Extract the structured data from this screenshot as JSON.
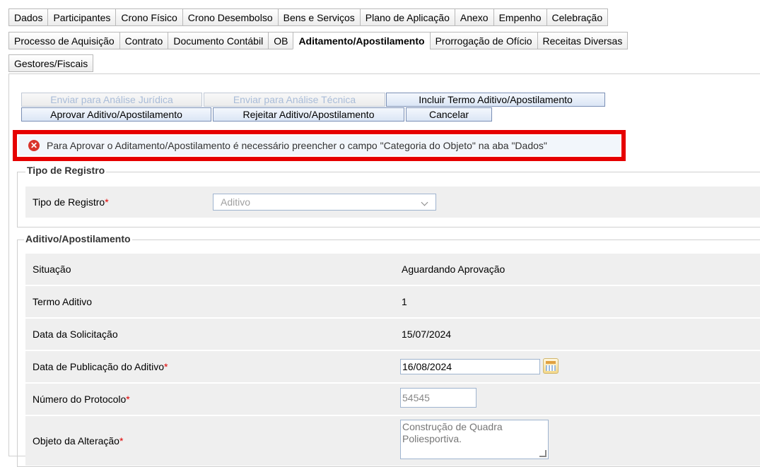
{
  "tabs": {
    "row1": [
      "Dados",
      "Participantes",
      "Crono Físico",
      "Crono Desembolso",
      "Bens e Serviços",
      "Plano de Aplicação",
      "Anexo",
      "Empenho",
      "Celebração"
    ],
    "row2": [
      "Processo de Aquisição",
      "Contrato",
      "Documento Contábil",
      "OB",
      "Aditamento/Apostilamento",
      "Prorrogação de Ofício",
      "Receitas Diversas"
    ],
    "row3": [
      "Gestores/Fiscais"
    ],
    "active": "Aditamento/Apostilamento"
  },
  "actions": {
    "enviar_juridica": "Enviar para Análise Jurídica",
    "enviar_tecnica": "Enviar para Análise Técnica",
    "incluir_termo": "Incluir Termo Aditivo/Apostilamento",
    "aprovar": "Aprovar Aditivo/Apostilamento",
    "rejeitar": "Rejeitar Aditivo/Apostilamento",
    "cancelar": "Cancelar"
  },
  "error": {
    "message": "Para Aprovar o Aditamento/Apostilamento é necessário preencher o campo \"Categoria do Objeto\" na aba \"Dados\"",
    "icon": "error-circle-icon"
  },
  "tipo_registro": {
    "legend": "Tipo de Registro",
    "label": "Tipo de Registro",
    "required_mark": "*",
    "value": "Aditivo"
  },
  "aditivo": {
    "legend": "Aditivo/Apostilamento",
    "situacao_label": "Situação",
    "situacao_value": "Aguardando Aprovação",
    "termo_label": "Termo Aditivo",
    "termo_value": "1",
    "data_solicitacao_label": "Data da Solicitação",
    "data_solicitacao_value": "15/07/2024",
    "data_publicacao_label": "Data de Publicação do Aditivo",
    "data_publicacao_value": "16/08/2024",
    "protocolo_label": "Número do Protocolo",
    "protocolo_value": "54545",
    "objeto_label": "Objeto da Alteração",
    "objeto_value": "Construção de Quadra Poliesportiva.",
    "required_mark": "*"
  },
  "colors": {
    "error_border": "#e60000",
    "required": "#e00000",
    "row_bg": "#efefef"
  }
}
